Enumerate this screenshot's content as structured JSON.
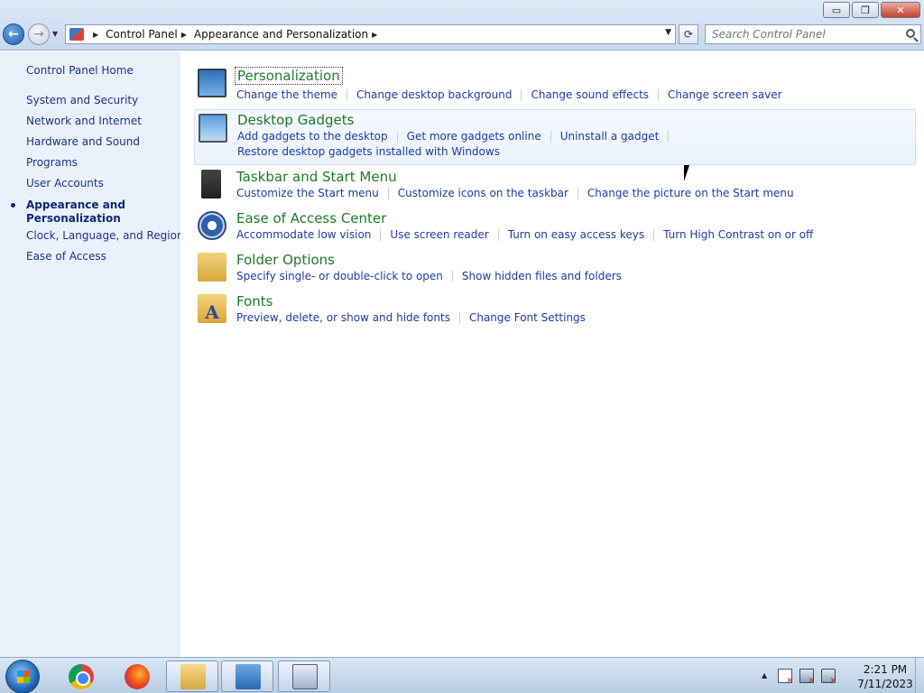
{
  "window": {
    "minimize": "▭",
    "restore": "❐",
    "close": "✕"
  },
  "address": {
    "crumbs": [
      "Control Panel",
      "Appearance and Personalization"
    ],
    "icon": "control-panel-icon"
  },
  "search": {
    "placeholder": "Search Control Panel"
  },
  "sidebar": {
    "home": "Control Panel Home",
    "items": [
      "System and Security",
      "Network and Internet",
      "Hardware and Sound",
      "Programs",
      "User Accounts"
    ],
    "current_line1": "Appearance and",
    "current_line2": "Personalization",
    "after": [
      "Clock, Language, and Region",
      "Ease of Access"
    ]
  },
  "categories": [
    {
      "title": "Personalization",
      "icon": "personalization-icon",
      "links": [
        "Change the theme",
        "Change desktop background",
        "Change sound effects",
        "Change screen saver"
      ]
    },
    {
      "title": "Desktop Gadgets",
      "icon": "gadgets-icon",
      "links": [
        "Add gadgets to the desktop",
        "Get more gadgets online",
        "Uninstall a gadget"
      ],
      "links2": [
        "Restore desktop gadgets installed with Windows"
      ]
    },
    {
      "title": "Taskbar and Start Menu",
      "icon": "taskbar-icon",
      "links": [
        "Customize the Start menu",
        "Customize icons on the taskbar",
        "Change the picture on the Start menu"
      ]
    },
    {
      "title": "Ease of Access Center",
      "icon": "ease-of-access-icon",
      "links": [
        "Accommodate low vision",
        "Use screen reader",
        "Turn on easy access keys",
        "Turn High Contrast on or off"
      ]
    },
    {
      "title": "Folder Options",
      "icon": "folder-options-icon",
      "links": [
        "Specify single- or double-click to open",
        "Show hidden files and folders"
      ]
    },
    {
      "title": "Fonts",
      "icon": "fonts-icon",
      "glyph": "A",
      "links": [
        "Preview, delete, or show and hide fonts",
        "Change Font Settings"
      ]
    }
  ],
  "taskbar": {
    "time": "2:21 PM",
    "date": "7/11/2023"
  },
  "colors": {
    "category_title": "#1e7a29",
    "link": "#1e3c9e",
    "sidebar_bg": "#eaf1fb"
  }
}
